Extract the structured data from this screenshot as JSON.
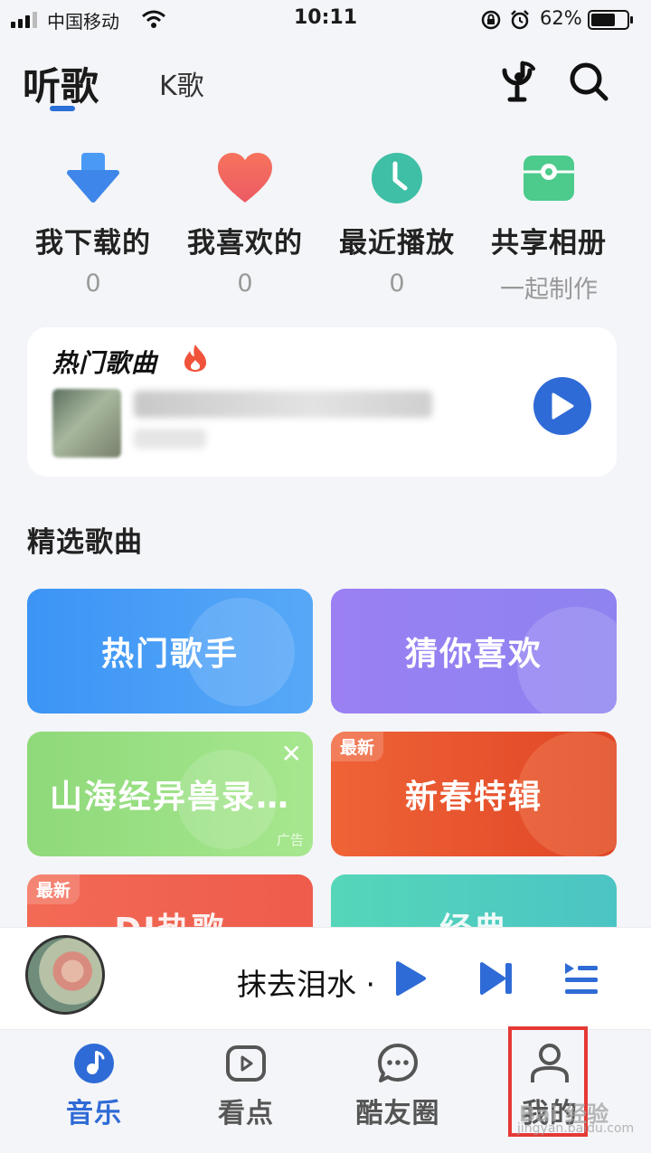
{
  "status_bar": {
    "carrier": "中国移动",
    "time": "10:11",
    "battery": "62%"
  },
  "header": {
    "tabs": [
      {
        "label": "听歌",
        "active": true
      },
      {
        "label": "K歌",
        "active": false
      }
    ],
    "icons": [
      "mic-music-icon",
      "search-icon"
    ]
  },
  "quick_items": [
    {
      "label": "我下载的",
      "sub": "0",
      "icon": "download-icon"
    },
    {
      "label": "我喜欢的",
      "sub": "0",
      "icon": "heart-icon"
    },
    {
      "label": "最近播放",
      "sub": "0",
      "icon": "clock-icon"
    },
    {
      "label": "共享相册",
      "sub": "一起制作",
      "icon": "shared-album-icon"
    }
  ],
  "hot_card": {
    "title": "热门歌曲",
    "icon": "fire-icon"
  },
  "section_title": "精选歌曲",
  "tiles": [
    {
      "label": "热门歌手"
    },
    {
      "label": "猜你喜欢"
    },
    {
      "label": "山海经异兽录…",
      "ad": "广告"
    },
    {
      "label": "新春特辑",
      "tag": "最新"
    },
    {
      "label": "DJ热歌",
      "tag": "最新"
    },
    {
      "label": "经典"
    }
  ],
  "player": {
    "song_title": "抹去泪水 ·"
  },
  "nav": [
    {
      "label": "音乐",
      "icon": "music-note-icon",
      "active": true
    },
    {
      "label": "看点",
      "icon": "video-icon",
      "active": false
    },
    {
      "label": "酷友圈",
      "icon": "chat-bubble-icon",
      "active": false
    },
    {
      "label": "我的",
      "icon": "profile-icon",
      "active": false
    }
  ],
  "watermark": {
    "text": "Bai 经验",
    "sub": "jingyan.baidu.com"
  },
  "colors": {
    "accent": "#2f6bd6",
    "highlight_box": "#e53935"
  }
}
